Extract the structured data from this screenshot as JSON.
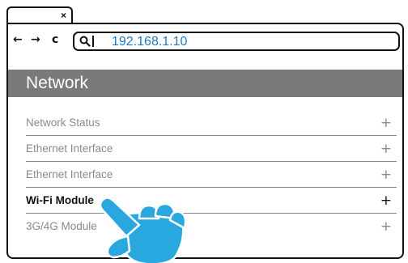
{
  "browser": {
    "tab_close": "×",
    "nav": {
      "back": "←",
      "forward": "→",
      "reload": "c"
    },
    "address": {
      "value": "192.168.1.10",
      "icon": "search-icon"
    }
  },
  "page": {
    "title": "Network",
    "menu": [
      {
        "label": "Network Status",
        "expand": "+",
        "active": false
      },
      {
        "label": "Ethernet Interface",
        "expand": "+",
        "active": false
      },
      {
        "label": "Ethernet Interface",
        "expand": "+",
        "active": false
      },
      {
        "label": "Wi-Fi Module",
        "expand": "+",
        "active": true
      },
      {
        "label": "3G/4G Module",
        "expand": "+",
        "active": false
      }
    ]
  },
  "colors": {
    "header_bg": "#7a7a7a",
    "address_text": "#1f78c1",
    "hand_fill": "#29a8e0",
    "inactive_text": "#8a8a8a"
  }
}
